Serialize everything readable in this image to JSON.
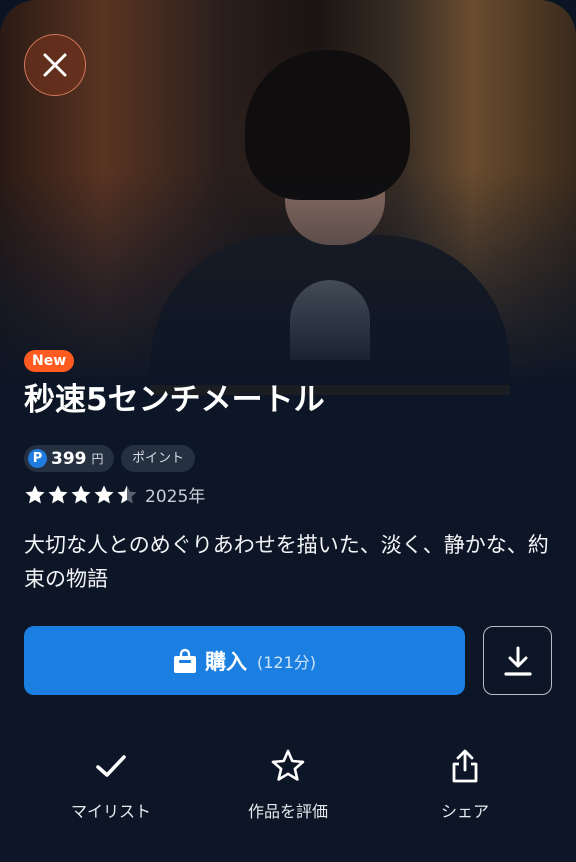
{
  "close_icon": "close-icon",
  "badge": "New",
  "title": "秒速5センチメートル",
  "price": {
    "icon_letter": "P",
    "amount": "399",
    "unit": "円"
  },
  "point_label": "ポイント",
  "rating": {
    "stars": 4.5,
    "max": 5
  },
  "year": "2025年",
  "description": "大切な人とのめぐりあわせを描いた、淡く、静かな、約束の物語",
  "buy": {
    "label": "購入",
    "duration": "(121分)",
    "icon": "shopping-bag-icon"
  },
  "download_icon": "download-icon",
  "actions": [
    {
      "label": "マイリスト",
      "icon": "check-icon"
    },
    {
      "label": "作品を評価",
      "icon": "star-outline-icon"
    },
    {
      "label": "シェア",
      "icon": "share-icon"
    }
  ],
  "colors": {
    "accent": "#1a7fe0",
    "badge": "#ff5a1f",
    "background": "#0d1626"
  }
}
